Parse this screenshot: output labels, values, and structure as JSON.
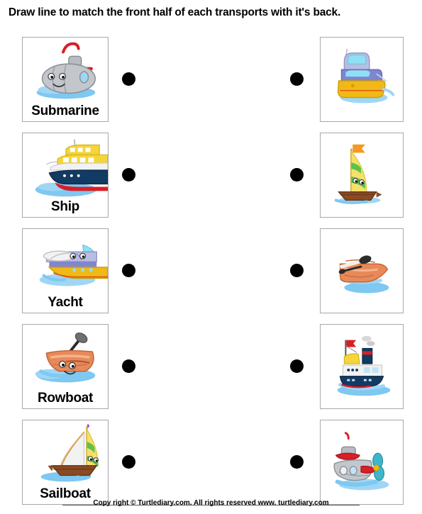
{
  "title": "Draw line to match the front half of each transports with it's back.",
  "footer": {
    "copyright": "Copy right © Turtlediary.com. All rights reserved   www. turtlediary.com"
  },
  "colors": {
    "card_border": "#a8a8a8",
    "dot": "#000000",
    "water": "#7ec8f2",
    "submarine_body": "#c3c6cb",
    "submarine_red": "#d81f26",
    "ship_hull": "#123a63",
    "ship_deck": "#f2f2f2",
    "ship_yellow": "#f5d53a",
    "yacht_hull": "#f0b917",
    "yacht_cabin": "#8f93d4",
    "rowboat": "#e8895a",
    "sail_yellow": "#f5e06a",
    "sail_green": "#5cc24a",
    "boat_wood": "#8a4b23",
    "flag_orange": "#f59a21"
  },
  "rows": [
    {
      "left": {
        "label": "Submarine",
        "art": "submarine-front"
      },
      "right": {
        "label": "",
        "art": "yacht-back"
      }
    },
    {
      "left": {
        "label": "Ship",
        "art": "ship-front"
      },
      "right": {
        "label": "",
        "art": "sailboat-back"
      }
    },
    {
      "left": {
        "label": "Yacht",
        "art": "yacht-front"
      },
      "right": {
        "label": "",
        "art": "rowboat-back"
      }
    },
    {
      "left": {
        "label": "Rowboat",
        "art": "rowboat-front"
      },
      "right": {
        "label": "",
        "art": "ship-back"
      }
    },
    {
      "left": {
        "label": "Sailboat",
        "art": "sailboat-front"
      },
      "right": {
        "label": "",
        "art": "submarine-back"
      }
    }
  ]
}
